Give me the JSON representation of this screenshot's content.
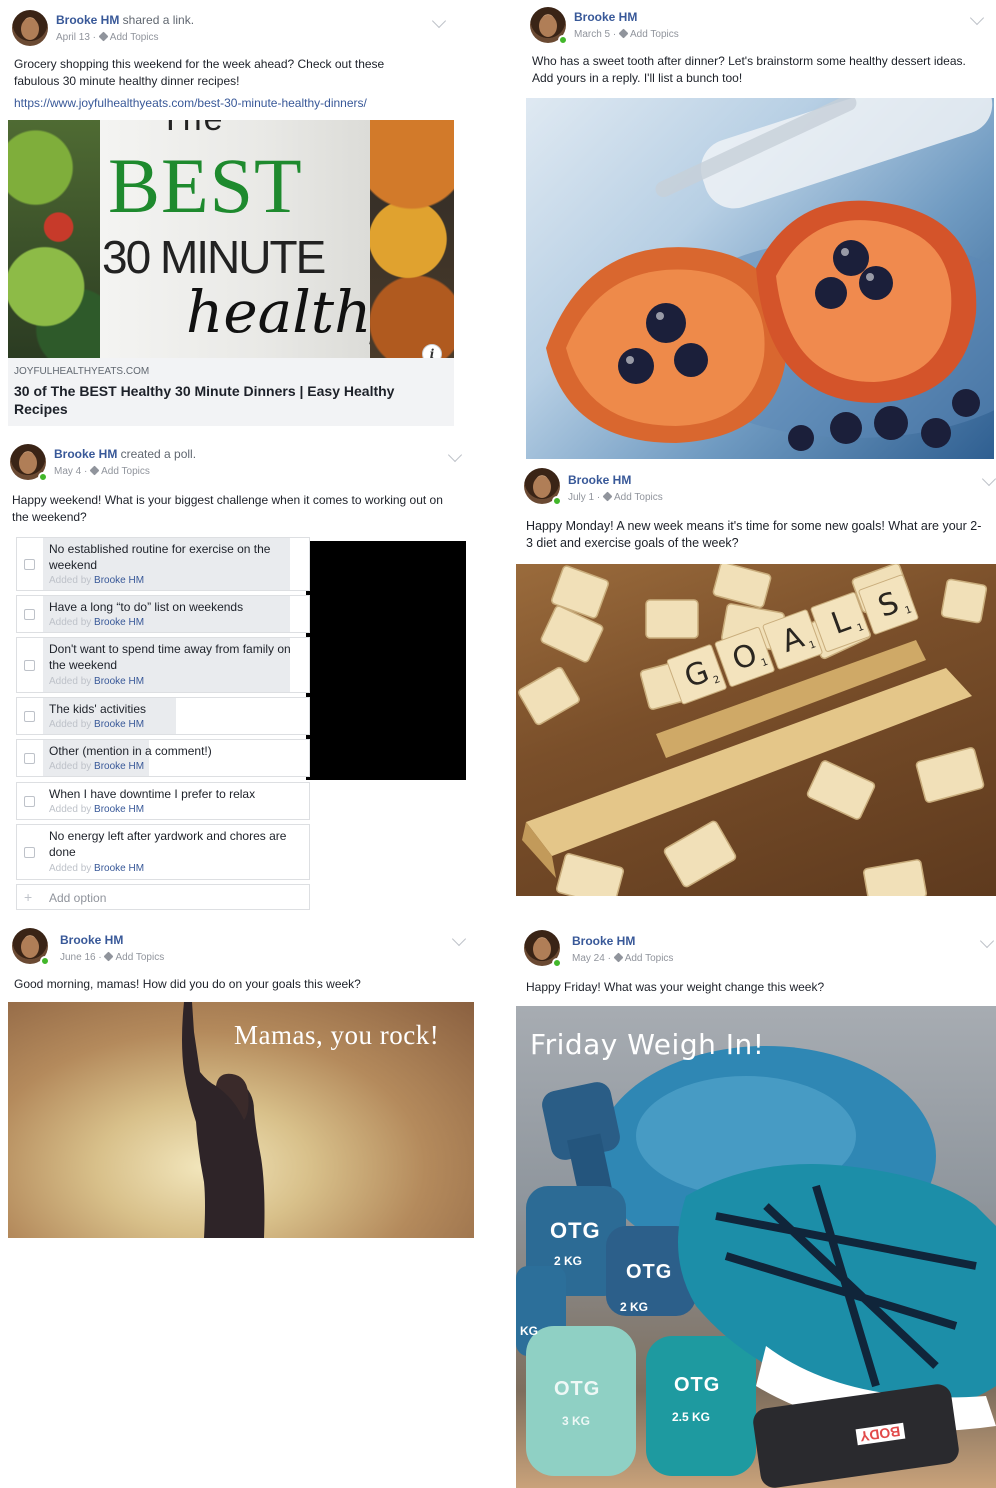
{
  "posts": {
    "link_post": {
      "author": "Brooke HM",
      "action": " shared a link.",
      "date": "April 13",
      "topics": "Add Topics",
      "text": "Grocery shopping this weekend for the week ahead? Check out these fabulous 30 minute healthy dinner recipes!",
      "url": "https://www.joyfulhealthyeats.com/best-30-minute-healthy-dinners/",
      "card": {
        "img_top": "The",
        "img_best": "BEST",
        "img_30": "30 MINUTE",
        "img_healthy": "healthy",
        "domain": "JOYFULHEALTHYEATS.COM",
        "title": "30 of The BEST Healthy 30 Minute Dinners | Easy Healthy Recipes",
        "info": "i"
      }
    },
    "dessert_post": {
      "author": "Brooke HM",
      "date": "March 5",
      "topics": "Add Topics",
      "text": "Who has a sweet tooth after dinner? Let's brainstorm some healthy dessert ideas. Add yours in a reply. I'll list a bunch too!"
    },
    "poll_post": {
      "author": "Brooke HM",
      "action": " created a poll.",
      "date": "May 4",
      "topics": "Add Topics",
      "text": "Happy weekend! What is your biggest challenge when it comes to working out on the weekend?",
      "added_by_prefix": "Added by ",
      "options": [
        {
          "label": "No established routine for exercise on the weekend",
          "by": "Brooke HM",
          "fill": 0.93
        },
        {
          "label": "Have a long “to do” list on weekends",
          "by": "Brooke HM",
          "fill": 0.93
        },
        {
          "label": "Don't want to spend time away from family on the weekend",
          "by": "Brooke HM",
          "fill": 0.93
        },
        {
          "label": "The kids' activities",
          "by": "Brooke HM",
          "fill": 0.5
        },
        {
          "label": "Other (mention in a comment!)",
          "by": "Brooke HM",
          "fill": 0.4
        },
        {
          "label": "When I have downtime I prefer to relax",
          "by": "Brooke HM",
          "fill": 0.0
        },
        {
          "label": "No energy left after yardwork and chores are done",
          "by": "Brooke HM",
          "fill": 0.0
        }
      ],
      "add_option": "Add option"
    },
    "goals_post": {
      "author": "Brooke HM",
      "date": "July 1",
      "topics": "Add Topics",
      "text": "Happy Monday! A new week means it's time for some new goals! What are your 2-3 diet and exercise goals of the week?",
      "tiles": [
        {
          "letter": "G",
          "num": "2"
        },
        {
          "letter": "O",
          "num": "1"
        },
        {
          "letter": "A",
          "num": "1"
        },
        {
          "letter": "L",
          "num": "1"
        },
        {
          "letter": "S",
          "num": "1"
        }
      ]
    },
    "mamas_post": {
      "author": "Brooke HM",
      "date": "June 16",
      "topics": "Add Topics",
      "text": "Good morning, mamas! How did you do on your goals this week?",
      "img_text": "Mamas, you rock!"
    },
    "weigh_post": {
      "author": "Brooke HM",
      "date": "May 24",
      "topics": "Add Topics",
      "text": "Happy Friday! What was your weight change this week?",
      "img_text": "Friday Weigh In!",
      "weights": [
        "2 KG",
        "2 KG",
        "KG",
        "3 KG",
        "2.5 KG"
      ],
      "brand": "OTG",
      "shoe_brand": "BODY"
    }
  }
}
